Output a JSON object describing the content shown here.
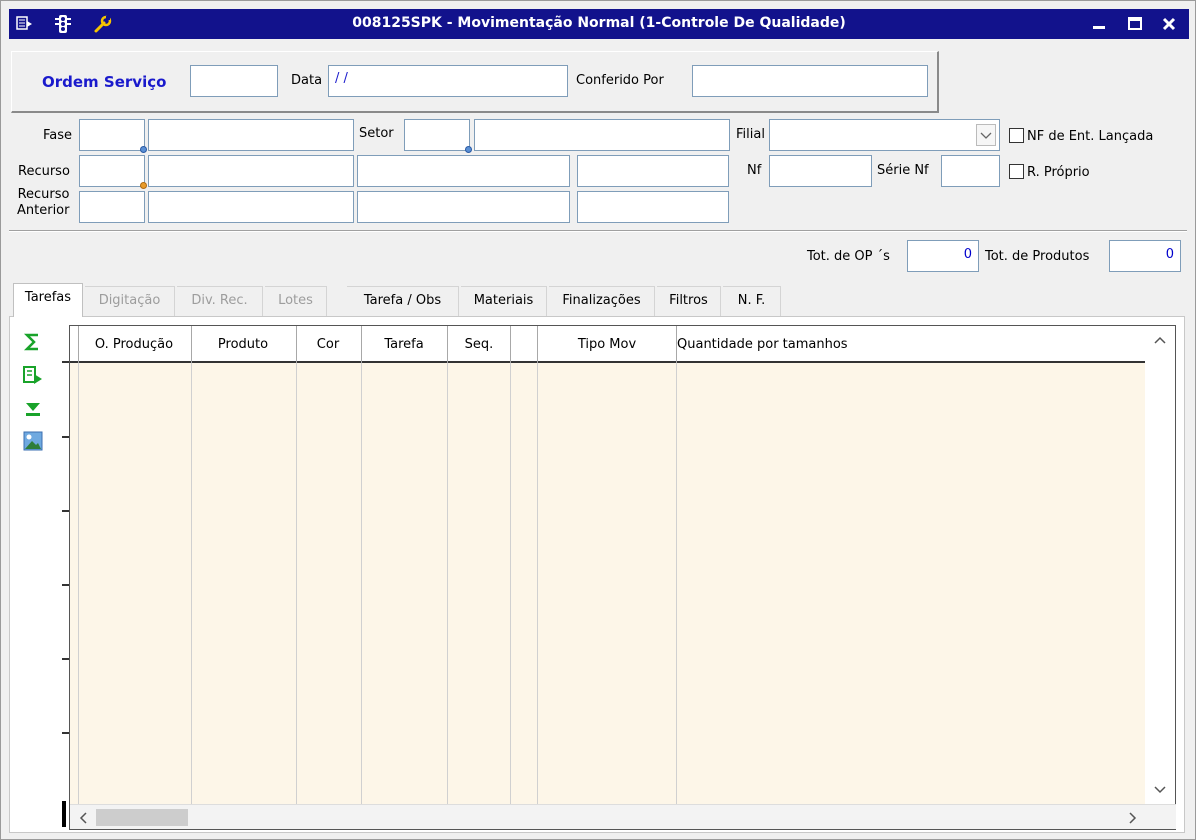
{
  "window": {
    "title": "008125SPK - Movimentação Normal (1-Controle De Qualidade)",
    "title_bg": "#12128c",
    "icons": [
      "menu-icon",
      "traffic-light-icon",
      "wrench-icon"
    ],
    "controls": [
      "minimize-icon",
      "maximize-icon",
      "close-icon"
    ]
  },
  "header": {
    "ordem_servico_label": "Ordem Serviço",
    "ordem_servico_value": "",
    "data_label": "Data",
    "data_value": " / /",
    "conferido_label": "Conferido Por",
    "conferido_value": ""
  },
  "form": {
    "fase_label": "Fase",
    "setor_label": "Setor",
    "filial_label": "Filial",
    "filial_value": "",
    "nf_ent_label": "NF de Ent. Lançada",
    "recurso_label": "Recurso",
    "nf_label": "Nf",
    "serie_nf_label": "Série Nf",
    "r_proprio_label": "R. Próprio",
    "recurso_anterior_label_1": "Recurso",
    "recurso_anterior_label_2": "Anterior"
  },
  "totals": {
    "tot_op_label": "Tot. de OP ´s",
    "tot_op_value": "0",
    "tot_prod_label": "Tot. de Produtos",
    "tot_prod_value": "0",
    "value_color": "#0000cc"
  },
  "tabs": [
    {
      "label": "Tarefas",
      "state": "active"
    },
    {
      "label": "Digitação",
      "state": "disabled"
    },
    {
      "label": "Div. Rec.",
      "state": "disabled"
    },
    {
      "label": "Lotes",
      "state": "disabled"
    },
    {
      "label": "Tarefa / Obs",
      "state": "normal"
    },
    {
      "label": "Materiais",
      "state": "normal"
    },
    {
      "label": "Finalizações",
      "state": "normal"
    },
    {
      "label": "Filtros",
      "state": "normal"
    },
    {
      "label": "N. F.",
      "state": "normal"
    }
  ],
  "grid": {
    "columns": [
      "O. Produção",
      "Produto",
      "Cor",
      "Tarefa",
      "Seq.",
      "",
      "Tipo Mov",
      "Quantidade por tamanhos"
    ],
    "rows": [],
    "body_color": "#fdf6e8"
  },
  "side_tools": [
    "sum-icon",
    "export-icon",
    "arrow-down-icon",
    "image-icon"
  ]
}
